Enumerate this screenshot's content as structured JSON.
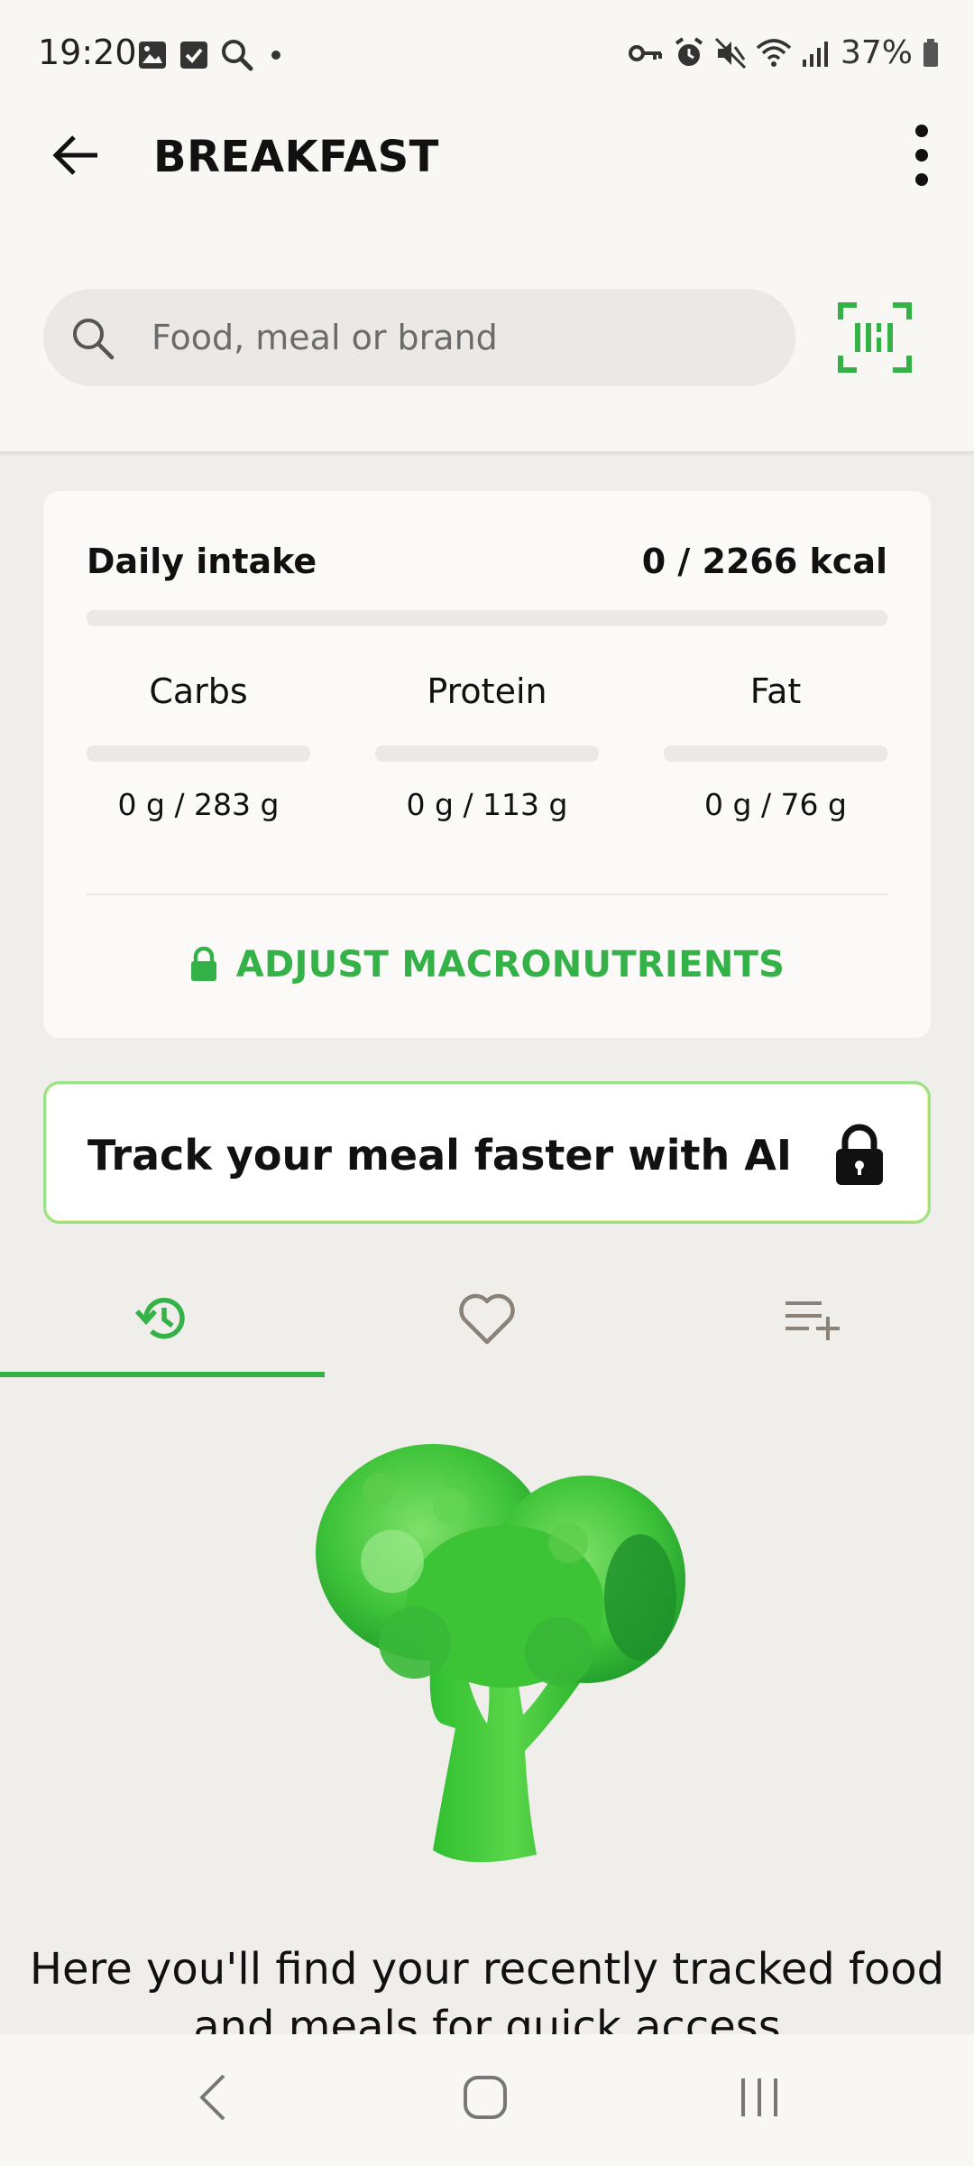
{
  "status_bar": {
    "time": "19:20",
    "battery": "37%"
  },
  "header": {
    "title": "BREAKFAST"
  },
  "search": {
    "placeholder": "Food, meal or brand"
  },
  "intake": {
    "label": "Daily intake",
    "value": "0 / 2266 kcal",
    "progress": 0,
    "macros": [
      {
        "name": "Carbs",
        "amount": "0 g / 283 g",
        "progress": 0
      },
      {
        "name": "Protein",
        "amount": "0 g / 113 g",
        "progress": 0
      },
      {
        "name": "Fat",
        "amount": "0 g / 76 g",
        "progress": 0
      }
    ],
    "adjust_label": "ADJUST MACRONUTRIENTS"
  },
  "ai_banner": {
    "text": "Track your meal faster with AI"
  },
  "tabs": {
    "active": "recent",
    "items": [
      "recent-history-icon",
      "favorites-heart-icon",
      "add-to-list-icon"
    ]
  },
  "empty_state": {
    "text": "Here you'll find your recently tracked food and meals for quick access"
  },
  "colors": {
    "accent": "#34b247",
    "background": "#f0eeeb",
    "card": "#fbfaf8"
  }
}
